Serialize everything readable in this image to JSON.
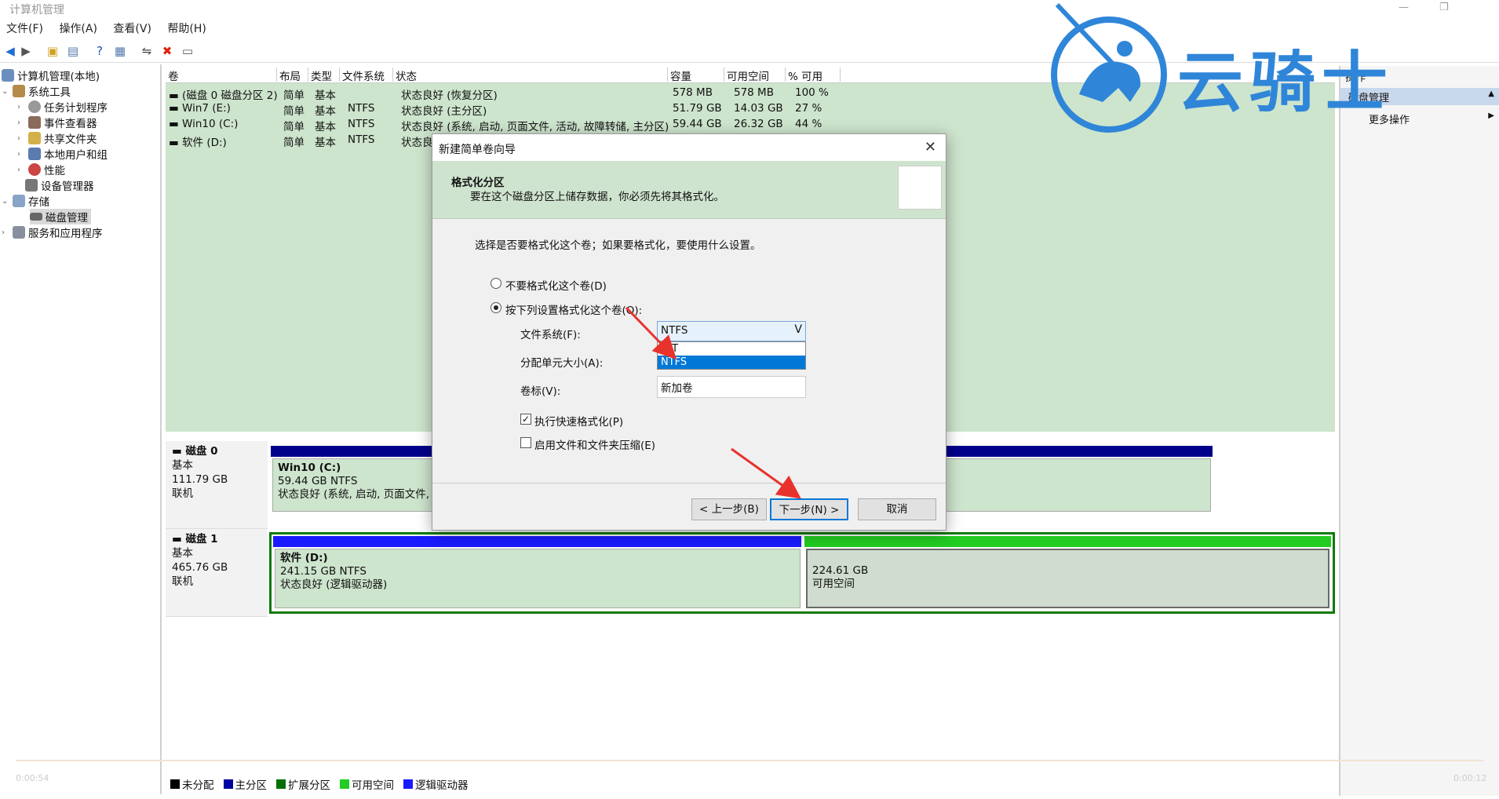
{
  "window": {
    "title": "计算机管理"
  },
  "menu": [
    "文件(F)",
    "操作(A)",
    "查看(V)",
    "帮助(H)"
  ],
  "tree": {
    "root": "计算机管理(本地)",
    "system_tools": "系统工具",
    "task_scheduler": "任务计划程序",
    "event_viewer": "事件查看器",
    "shared_folders": "共享文件夹",
    "local_users": "本地用户和组",
    "performance": "性能",
    "device_manager": "设备管理器",
    "storage": "存储",
    "disk_management": "磁盘管理",
    "services_apps": "服务和应用程序"
  },
  "columns": [
    "卷",
    "布局",
    "类型",
    "文件系统",
    "状态",
    "容量",
    "可用空间",
    "% 可用"
  ],
  "volumes": [
    {
      "name": "(磁盘 0 磁盘分区 2)",
      "layout": "简单",
      "type": "基本",
      "fs": "",
      "status": "状态良好 (恢复分区)",
      "capacity": "578 MB",
      "free": "578 MB",
      "pct": "100 %"
    },
    {
      "name": "Win7 (E:)",
      "layout": "简单",
      "type": "基本",
      "fs": "NTFS",
      "status": "状态良好 (主分区)",
      "capacity": "51.79 GB",
      "free": "14.03 GB",
      "pct": "27 %"
    },
    {
      "name": "Win10 (C:)",
      "layout": "简单",
      "type": "基本",
      "fs": "NTFS",
      "status": "状态良好 (系统, 启动, 页面文件, 活动, 故障转储, 主分区)",
      "capacity": "59.44 GB",
      "free": "26.32 GB",
      "pct": "44 %"
    },
    {
      "name": "软件 (D:)",
      "layout": "简单",
      "type": "基本",
      "fs": "NTFS",
      "status": "状态良",
      "capacity": "",
      "free": "",
      "pct": ""
    }
  ],
  "disk0": {
    "title": "磁盘 0",
    "kind": "基本",
    "size": "111.79 GB",
    "state": "联机",
    "part_name": "Win10  (C:)",
    "part_size": "59.44 GB NTFS",
    "part_status": "状态良好 (系统, 启动, 页面文件, 活"
  },
  "disk1": {
    "title": "磁盘 1",
    "kind": "基本",
    "size": "465.76 GB",
    "state": "联机",
    "part_name": "软件  (D:)",
    "part_size": "241.15 GB NTFS",
    "part_status": "状态良好 (逻辑驱动器)",
    "free_size": "224.61 GB",
    "free_label": "可用空间"
  },
  "legend": [
    {
      "label": "未分配",
      "color": "#000000"
    },
    {
      "label": "主分区",
      "color": "#0000a0"
    },
    {
      "label": "扩展分区",
      "color": "#007000"
    },
    {
      "label": "可用空间",
      "color": "#22cc22"
    },
    {
      "label": "逻辑驱动器",
      "color": "#1a1aff"
    }
  ],
  "actions": {
    "header": "操作",
    "section": "磁盘管理",
    "more": "更多操作"
  },
  "dialog": {
    "title": "新建简单卷向导",
    "heading": "格式化分区",
    "subheading": "要在这个磁盘分区上储存数据，你必须先将其格式化。",
    "prompt": "选择是否要格式化这个卷；如果要格式化，要使用什么设置。",
    "opt_no_format": "不要格式化这个卷(D)",
    "opt_format": "按下列设置格式化这个卷(O):",
    "fs_label": "文件系统(F):",
    "fs_value": "NTFS",
    "fs_options": [
      "FAT",
      "NTFS"
    ],
    "alloc_label": "分配单元大小(A):",
    "vol_label": "卷标(V):",
    "vol_value": "新加卷",
    "quick_format": "执行快速格式化(P)",
    "compress": "启用文件和文件夹压缩(E)",
    "back": "< 上一步(B)",
    "next": "下一步(N) >",
    "cancel": "取消"
  },
  "watermark": {
    "text": "云骑士"
  },
  "video": {
    "time_left": "0:00:54",
    "time_right": "0:00:12"
  },
  "colors": {
    "volume_bg": "#cde4cd",
    "selected_blue": "#0078d7",
    "arrow_red": "#e8322d",
    "brand_blue": "#2f86d8"
  }
}
